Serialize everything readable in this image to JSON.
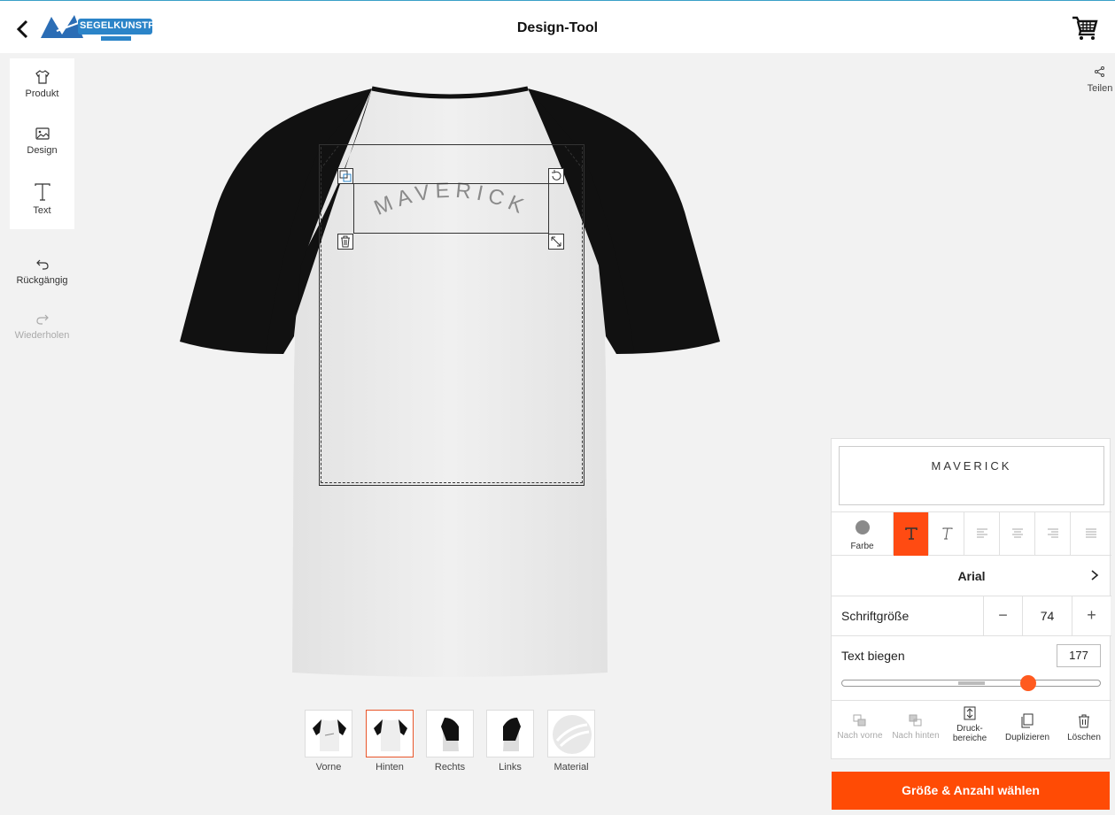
{
  "header": {
    "title": "Design-Tool",
    "logo_text": "SEGELKUNSTFLUG"
  },
  "sidebar": {
    "tools": [
      {
        "label": "Produkt",
        "icon": "tshirt-icon"
      },
      {
        "label": "Design",
        "icon": "image-icon"
      },
      {
        "label": "Text",
        "icon": "text-icon"
      }
    ],
    "undo_label": "Rückgängig",
    "redo_label": "Wiederholen"
  },
  "share": {
    "label": "Teilen"
  },
  "canvas": {
    "design_text": "MAVERICK",
    "text_color": "#8a8a8a",
    "shirt_body_color": "#ededed",
    "shirt_sleeve_color": "#111111"
  },
  "views": [
    {
      "label": "Vorne",
      "active": false
    },
    {
      "label": "Hinten",
      "active": true
    },
    {
      "label": "Rechts",
      "active": false
    },
    {
      "label": "Links",
      "active": false
    },
    {
      "label": "Material",
      "active": false
    }
  ],
  "text_panel": {
    "text_value": "MAVERICK",
    "color_label": "Farbe",
    "font_name": "Arial",
    "font_size_label": "Schriftgröße",
    "font_size_value": "74",
    "bend_label": "Text biegen",
    "bend_value": "177",
    "bend_slider_fraction": 0.73,
    "actions": {
      "bring_forward": "Nach vorne",
      "send_backward": "Nach hinten",
      "print_areas_line1": "Druck-",
      "print_areas_line2": "bereiche",
      "duplicate": "Duplizieren",
      "delete": "Löschen"
    }
  },
  "cta": {
    "label": "Größe & Anzahl wählen"
  },
  "colors": {
    "accent": "#ff4b05",
    "header_border": "#3aa0c8"
  }
}
